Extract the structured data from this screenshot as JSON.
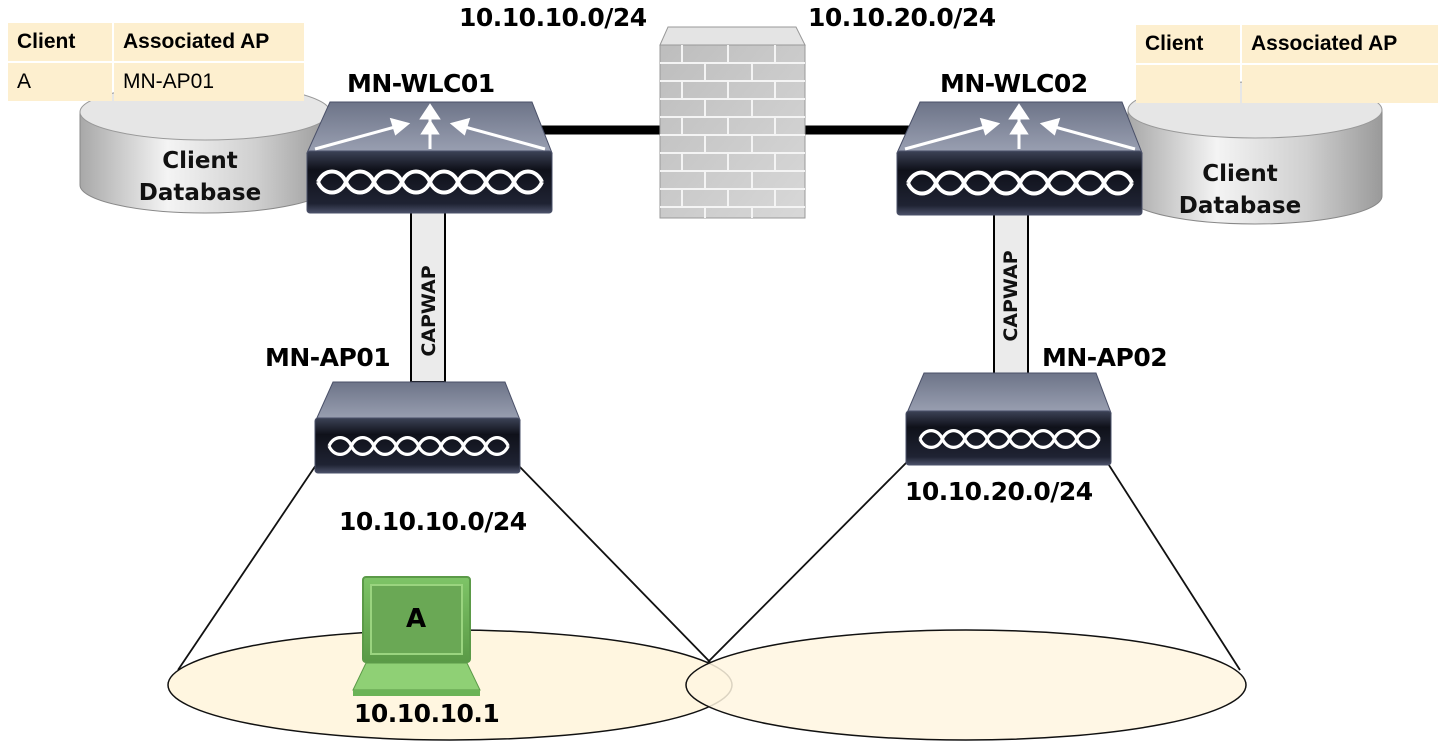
{
  "diagram": {
    "top_subnets": {
      "left": "10.10.10.0/24",
      "right": "10.10.20.0/24"
    },
    "controllers": [
      {
        "id": "wlc1",
        "name": "MN-WLC01",
        "database_label_line1": "Client",
        "database_label_line2": "Database"
      },
      {
        "id": "wlc2",
        "name": "MN-WLC02",
        "database_label_line1": "Client",
        "database_label_line2": "Database"
      }
    ],
    "access_points": [
      {
        "id": "ap1",
        "name": "MN-AP01",
        "subnet": "10.10.10.0/24",
        "tunnel_label": "CAPWAP"
      },
      {
        "id": "ap2",
        "name": "MN-AP02",
        "subnet": "10.10.20.0/24",
        "tunnel_label": "CAPWAP"
      }
    ],
    "client": {
      "label": "A",
      "ip": "10.10.10.1"
    },
    "tables": [
      {
        "headers": [
          "Client",
          "Associated AP"
        ],
        "rows": [
          [
            "A",
            "MN-AP01"
          ]
        ]
      },
      {
        "headers": [
          "Client",
          "Associated AP"
        ],
        "rows": [
          [
            "",
            ""
          ]
        ]
      }
    ],
    "colors": {
      "table_fill": "#fdefcf",
      "coverage_fill": "#fff6e0",
      "device_dark": "#1c1f2b",
      "device_top": "#7c8398",
      "laptop_green": "#7cc365",
      "firewall_gray": "#c8c8c8",
      "capwap_fill": "#ebebeb"
    }
  }
}
